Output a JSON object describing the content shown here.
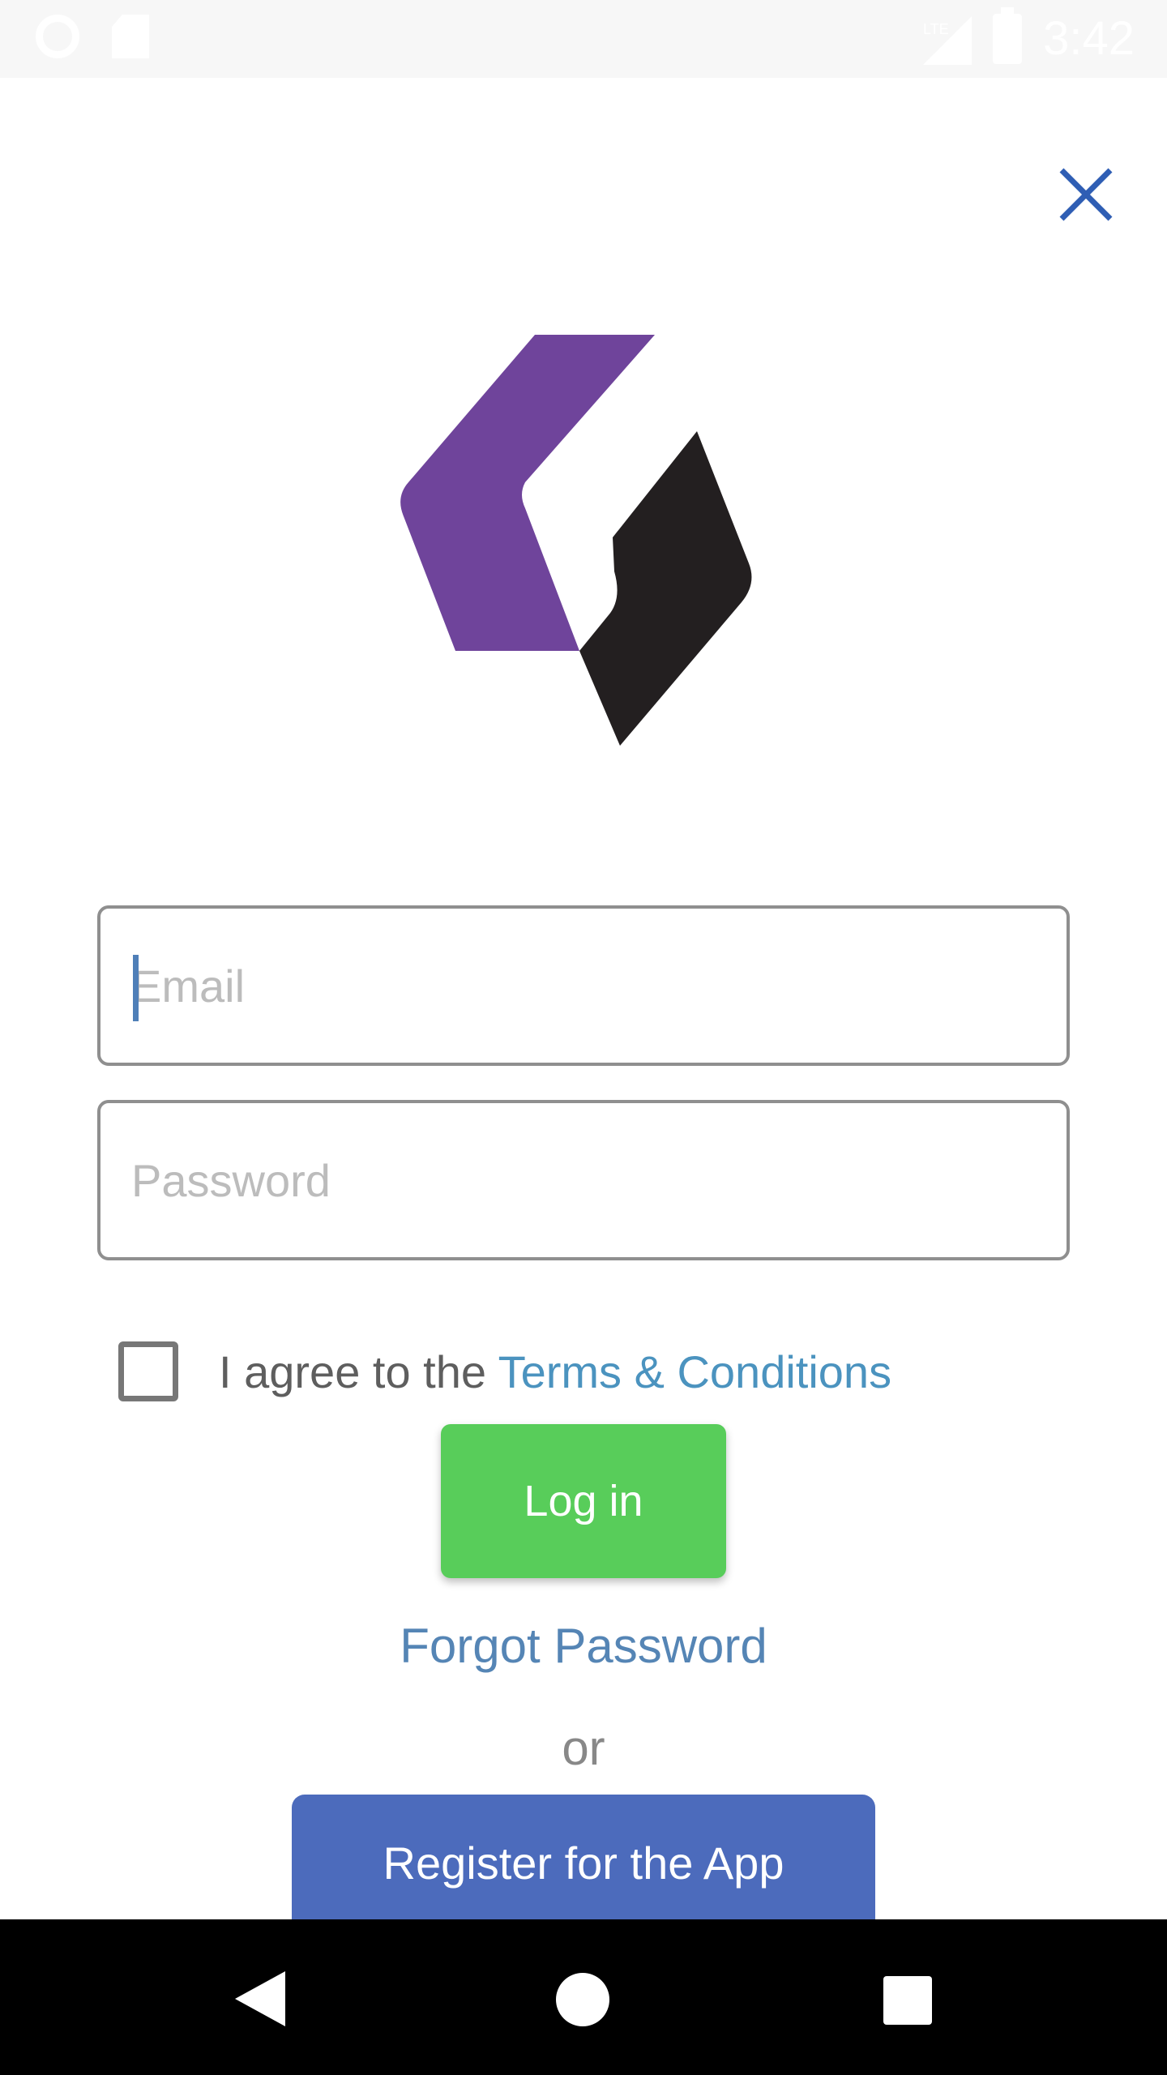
{
  "status_bar": {
    "time": "3:42",
    "network_label": "LTE",
    "icons": [
      "circle-notification-icon",
      "sd-card-icon",
      "lte-signal-icon",
      "battery-charging-icon"
    ]
  },
  "header": {
    "close_icon": "close-icon"
  },
  "brand": {
    "logo_colors": {
      "purple": "#6f449b",
      "dark": "#231f20"
    }
  },
  "login_form": {
    "email_placeholder": "Email",
    "password_placeholder": "Password",
    "terms_prefix": "I agree to the ",
    "terms_link": "Terms & Conditions",
    "terms_checked": false,
    "login_label": "Log in",
    "forgot_password_label": "Forgot Password",
    "or_label": "or",
    "register_label": "Register for the App"
  },
  "colors": {
    "close": "#2f5eb4",
    "login_button": "#58cd5a",
    "register_button": "#4c6bbc",
    "link": "#4b93bf"
  },
  "nav_bar": {
    "icons": [
      "back-icon",
      "home-icon",
      "recents-icon"
    ]
  }
}
